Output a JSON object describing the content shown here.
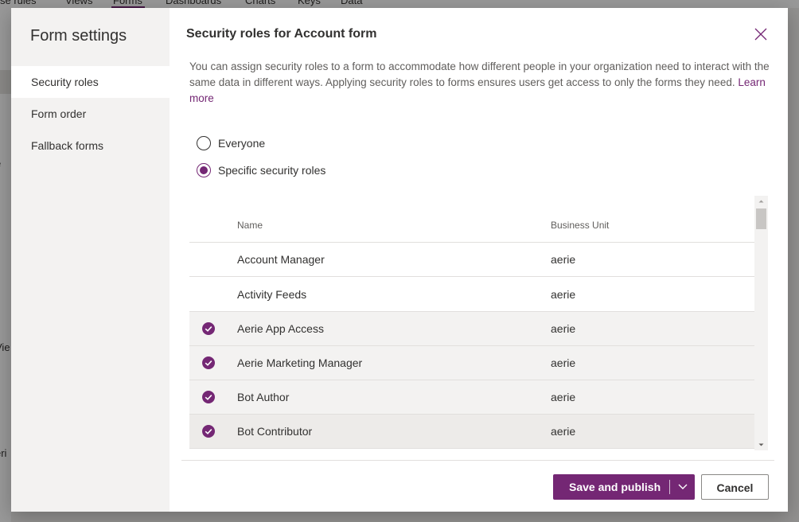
{
  "background": {
    "nav_items": [
      "se rules",
      "Views",
      "Forms",
      "Dashboards",
      "Charts",
      "Keys",
      "Data"
    ],
    "left_fragments": [
      "e",
      "Vie",
      "eri"
    ]
  },
  "sidebar": {
    "title": "Form settings",
    "items": [
      {
        "label": "Security roles",
        "active": true
      },
      {
        "label": "Form order",
        "active": false
      },
      {
        "label": "Fallback forms",
        "active": false
      }
    ]
  },
  "main": {
    "title": "Security roles for Account form",
    "close_icon": "close-icon",
    "description": "You can assign security roles to a form to accommodate how different people in your organization need to interact with the same data in different ways. Applying security roles to forms ensures users get access to only the forms they need.",
    "learn_more": "Learn more",
    "radio_options": [
      {
        "label": "Everyone",
        "checked": false
      },
      {
        "label": "Specific security roles",
        "checked": true
      }
    ]
  },
  "grid": {
    "columns": [
      "Name",
      "Business Unit"
    ],
    "rows": [
      {
        "name": "Account Manager",
        "business_unit": "aerie",
        "selected": false
      },
      {
        "name": "Activity Feeds",
        "business_unit": "aerie",
        "selected": false
      },
      {
        "name": "Aerie App Access",
        "business_unit": "aerie",
        "selected": true
      },
      {
        "name": "Aerie Marketing Manager",
        "business_unit": "aerie",
        "selected": true
      },
      {
        "name": "Bot Author",
        "business_unit": "aerie",
        "selected": true
      },
      {
        "name": "Bot Contributor",
        "business_unit": "aerie",
        "selected": true
      }
    ]
  },
  "footer": {
    "save_label": "Save and publish",
    "cancel_label": "Cancel"
  },
  "colors": {
    "accent": "#742774",
    "sidebar_bg": "#f3f2f1"
  }
}
